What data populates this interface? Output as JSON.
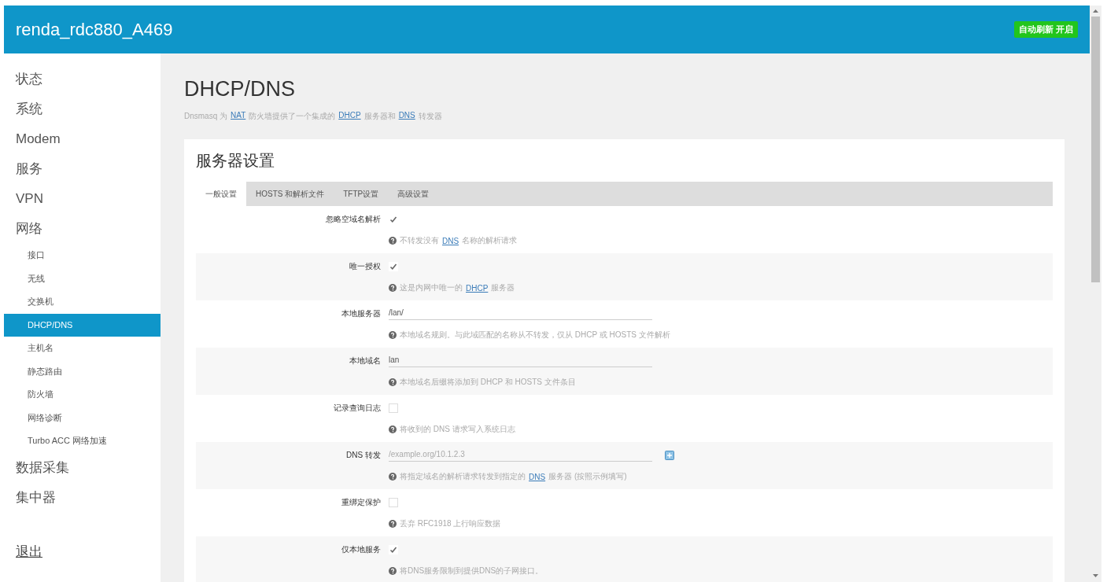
{
  "header": {
    "title": "renda_rdc880_A469",
    "badge": "自动刷新 开启"
  },
  "sidebar": {
    "items": [
      {
        "label": "状态",
        "selected": false
      },
      {
        "label": "系统",
        "selected": false
      },
      {
        "label": "Modem",
        "selected": false
      },
      {
        "label": "服务",
        "selected": false
      },
      {
        "label": "VPN",
        "selected": false
      },
      {
        "label": "网络",
        "selected": false,
        "children": [
          {
            "label": "接口",
            "selected": false
          },
          {
            "label": "无线",
            "selected": false
          },
          {
            "label": "交换机",
            "selected": false
          },
          {
            "label": "DHCP/DNS",
            "selected": true
          },
          {
            "label": "主机名",
            "selected": false
          },
          {
            "label": "静态路由",
            "selected": false
          },
          {
            "label": "防火墙",
            "selected": false
          },
          {
            "label": "网络诊断",
            "selected": false
          },
          {
            "label": "Turbo ACC 网络加速",
            "selected": false
          }
        ]
      },
      {
        "label": "数据采集",
        "selected": false
      },
      {
        "label": "集中器",
        "selected": false
      }
    ],
    "logout": "退出"
  },
  "page": {
    "title": "DHCP/DNS",
    "description": [
      {
        "kind": "text",
        "text": "Dnsmasq 为"
      },
      {
        "kind": "link",
        "text": "NAT"
      },
      {
        "kind": "text",
        "text": "防火墙提供了一个集成的"
      },
      {
        "kind": "link",
        "text": "DHCP"
      },
      {
        "kind": "text",
        "text": "服务器和"
      },
      {
        "kind": "link",
        "text": "DNS"
      },
      {
        "kind": "text",
        "text": "转发器"
      }
    ]
  },
  "section": {
    "title": "服务器设置",
    "tabs": [
      {
        "label": "一般设置",
        "selected": true
      },
      {
        "label": "HOSTS 和解析文件",
        "selected": false
      },
      {
        "label": "TFTP设置",
        "selected": false
      },
      {
        "label": "高级设置",
        "selected": false
      }
    ],
    "fields": [
      {
        "label": "忽略空域名解析",
        "kind": "checkbox",
        "checked": true,
        "help": [
          {
            "kind": "text",
            "text": "不转发没有"
          },
          {
            "kind": "link",
            "text": "DNS"
          },
          {
            "kind": "text",
            "text": "名称的解析请求"
          }
        ]
      },
      {
        "label": "唯一授权",
        "kind": "checkbox",
        "checked": true,
        "help": [
          {
            "kind": "text",
            "text": "这是内网中唯一的"
          },
          {
            "kind": "link",
            "text": "DHCP"
          },
          {
            "kind": "text",
            "text": "服务器"
          }
        ]
      },
      {
        "label": "本地服务器",
        "kind": "text",
        "value": "/lan/",
        "help": [
          {
            "kind": "text",
            "text": "本地域名规则。与此域匹配的名称从不转发，仅从 DHCP 或 HOSTS 文件解析"
          }
        ]
      },
      {
        "label": "本地域名",
        "kind": "text",
        "value": "lan",
        "help": [
          {
            "kind": "text",
            "text": "本地域名后缀将添加到 DHCP 和 HOSTS 文件条目"
          }
        ]
      },
      {
        "label": "记录查询日志",
        "kind": "checkbox",
        "checked": false,
        "help": [
          {
            "kind": "text",
            "text": "将收到的 DNS 请求写入系统日志"
          }
        ]
      },
      {
        "label": "DNS 转发",
        "kind": "list",
        "placeholder": "/example.org/10.1.2.3",
        "help": [
          {
            "kind": "text",
            "text": "将指定域名的解析请求转发到指定的"
          },
          {
            "kind": "link",
            "text": "DNS"
          },
          {
            "kind": "text",
            "text": "服务器 (按照示例填写)"
          }
        ]
      },
      {
        "label": "重绑定保护",
        "kind": "checkbox",
        "checked": false,
        "help": [
          {
            "kind": "text",
            "text": "丢弃 RFC1918 上行响应数据"
          }
        ]
      },
      {
        "label": "仅本地服务",
        "kind": "checkbox",
        "checked": true,
        "help": [
          {
            "kind": "text",
            "text": "将DNS服务限制到提供DNS的子网接口。"
          }
        ]
      }
    ]
  }
}
